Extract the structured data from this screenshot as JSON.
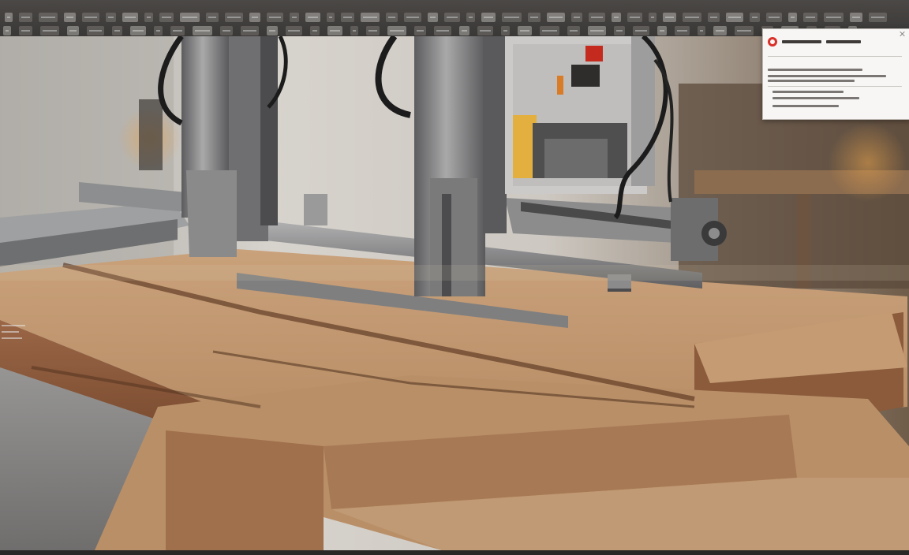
{
  "image": {
    "subject": "sawmill-machine",
    "toolbar_icons_row1": 44,
    "toolbar_icons_row2": 40
  },
  "colors": {
    "toolbar": "#3f3c3a",
    "wood_light": "#c49a72",
    "wood_dark": "#8a5a3a",
    "steel": "#7f7f80",
    "panel_accent": "#d9302a"
  },
  "icons": [
    "panel-logo-icon",
    "close-icon"
  ]
}
